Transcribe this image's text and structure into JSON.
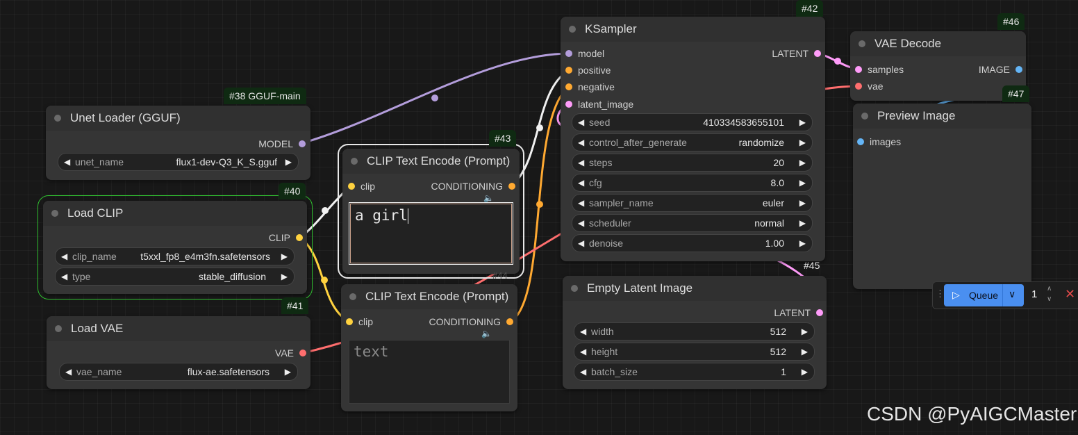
{
  "canvas": {
    "wire_colors": {
      "model": "#b39ddb",
      "clip": "#ffd23f",
      "conditioning": "#ffa931",
      "latent": "#ff9cf9",
      "vae": "#ff6e6e",
      "image": "#64b5f6"
    }
  },
  "nodes": {
    "unet_loader": {
      "badge": "#38 GGUF-main",
      "title": "Unet Loader (GGUF)",
      "output_label": "MODEL",
      "widget_name": "unet_name",
      "widget_value": "flux1-dev-Q3_K_S.gguf"
    },
    "load_clip": {
      "badge": "#40",
      "title": "Load CLIP",
      "output_label": "CLIP",
      "clip_name_label": "clip_name",
      "clip_name_value": "t5xxl_fp8_e4m3fn.safetensors",
      "type_label": "type",
      "type_value": "stable_diffusion"
    },
    "load_vae": {
      "badge": "#41",
      "title": "Load VAE",
      "output_label": "VAE",
      "widget_name": "vae_name",
      "widget_value": "flux-ae.safetensors"
    },
    "clip_pos": {
      "badge": "#43",
      "title": "CLIP Text Encode (Prompt)",
      "input_label": "clip",
      "output_label": "CONDITIONING",
      "text": "a girl"
    },
    "clip_neg": {
      "badge": "#44",
      "title": "CLIP Text Encode (Prompt)",
      "input_label": "clip",
      "output_label": "CONDITIONING",
      "placeholder": "text"
    },
    "ksampler": {
      "badge": "#42",
      "title": "KSampler",
      "inputs": [
        "model",
        "positive",
        "negative",
        "latent_image"
      ],
      "output_label": "LATENT",
      "widgets": [
        {
          "name": "seed",
          "value": "410334583655101"
        },
        {
          "name": "control_after_generate",
          "value": "randomize"
        },
        {
          "name": "steps",
          "value": "20"
        },
        {
          "name": "cfg",
          "value": "8.0"
        },
        {
          "name": "sampler_name",
          "value": "euler"
        },
        {
          "name": "scheduler",
          "value": "normal"
        },
        {
          "name": "denoise",
          "value": "1.00"
        }
      ]
    },
    "empty_latent": {
      "badge": "#45",
      "title": "Empty Latent Image",
      "output_label": "LATENT",
      "widgets": [
        {
          "name": "width",
          "value": "512"
        },
        {
          "name": "height",
          "value": "512"
        },
        {
          "name": "batch_size",
          "value": "1"
        }
      ]
    },
    "vae_decode": {
      "badge": "#46",
      "title": "VAE Decode",
      "input_samples": "samples",
      "input_vae": "vae",
      "output_label": "IMAGE"
    },
    "preview": {
      "badge": "#47",
      "title": "Preview Image",
      "input_label": "images"
    }
  },
  "queue": {
    "label": "Queue",
    "count": "1"
  },
  "watermark": "CSDN @PyAIGCMaster"
}
